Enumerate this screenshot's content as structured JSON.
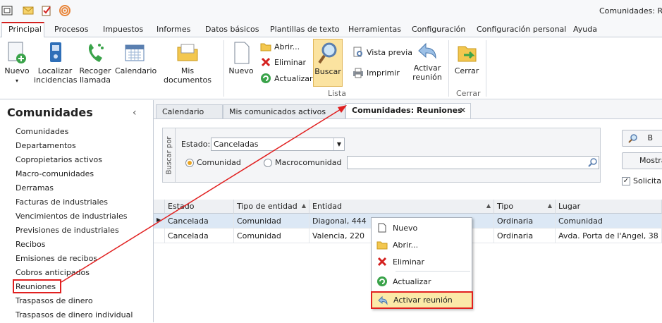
{
  "window": {
    "title": "Comunidades: Reu"
  },
  "ribbon_tabs": [
    "Principal",
    "Procesos",
    "Impuestos",
    "Informes",
    "Datos básicos",
    "Plantillas de texto",
    "Herramientas",
    "Configuración",
    "Configuración personal",
    "Ayuda"
  ],
  "ribbon": {
    "nuevo": "Nuevo",
    "localizar": "Localizar incidencias",
    "recoger": "Recoger llamada",
    "calendario": "Calendario",
    "mis_documentos": "Mis documentos",
    "nuevo2": "Nuevo",
    "abrir": "Abrir...",
    "eliminar": "Eliminar",
    "actualizar": "Actualizar",
    "buscar": "Buscar",
    "vista_previa": "Vista previa",
    "imprimir": "Imprimir",
    "activar": "Activar reunión",
    "cerrar": "Cerrar",
    "group_lista": "Lista",
    "group_cerrar": "Cerrar"
  },
  "sidebar": {
    "title": "Comunidades",
    "items": [
      "Comunidades",
      "Departamentos",
      "Copropietarios activos",
      "Macro-comunidades",
      "Derramas",
      "Facturas de industriales",
      "Vencimientos de industriales",
      "Previsiones de industriales",
      "Recibos",
      "Emisiones de recibos",
      "Cobros anticipados",
      "Reuniones",
      "Traspasos de dinero",
      "Traspasos de dinero individual"
    ]
  },
  "doc_tabs": [
    "Calendario",
    "Mis comunicados activos",
    "Comunidades: Reuniones"
  ],
  "filter": {
    "buscar_por": "Buscar por",
    "estado_label": "Estado:",
    "estado_value": "Canceladas",
    "radio_comunidad": "Comunidad",
    "radio_macro": "Macrocomunidad",
    "search_value": ""
  },
  "side_buttons": {
    "buscar": "B",
    "mostrar": "Mostra",
    "solicitar": "Solicitar"
  },
  "grid": {
    "columns": [
      "Estado",
      "Tipo de entidad",
      "Entidad",
      "Tipo",
      "Lugar"
    ],
    "rows": [
      [
        "Cancelada",
        "Comunidad",
        "Diagonal, 444",
        "Ordinaria",
        "Comunidad"
      ],
      [
        "Cancelada",
        "Comunidad",
        "Valencia, 220",
        "Ordinaria",
        "Avda. Porta de l'Angel, 38 ..."
      ]
    ]
  },
  "context_menu": [
    "Nuevo",
    "Abrir...",
    "Eliminar",
    "Actualizar",
    "Activar reunión"
  ],
  "colors": {
    "highlight": "#e12020",
    "accent": "#d4211f",
    "selected_row": "#dce8f5",
    "menu_hover": "#fbe9a8"
  }
}
